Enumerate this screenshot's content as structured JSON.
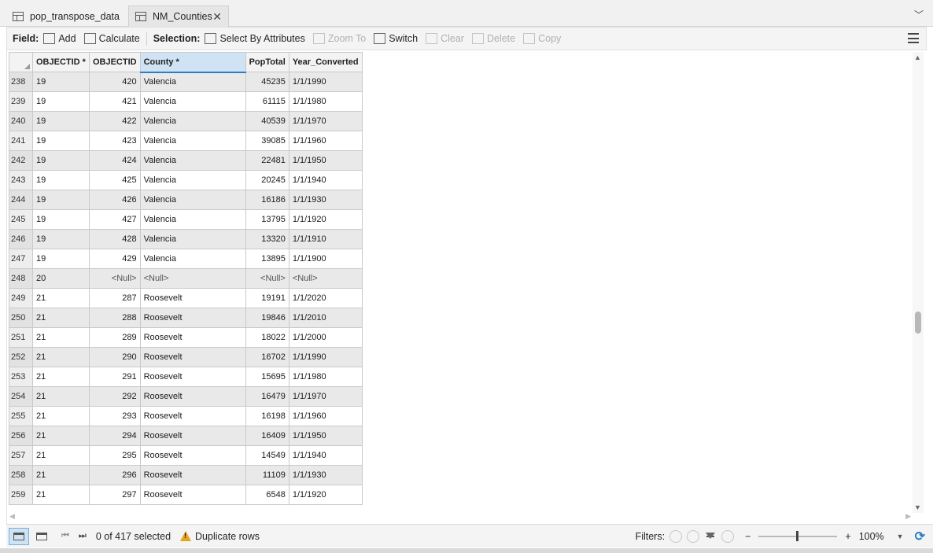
{
  "tabs": [
    {
      "label": "pop_transpose_data",
      "active": false
    },
    {
      "label": "NM_Counties",
      "active": true
    }
  ],
  "toolbar": {
    "field_label": "Field:",
    "add_label": "Add",
    "calculate_label": "Calculate",
    "selection_label": "Selection:",
    "select_by_attributes_label": "Select By Attributes",
    "zoom_to_label": "Zoom To",
    "switch_label": "Switch",
    "clear_label": "Clear",
    "delete_label": "Delete",
    "copy_label": "Copy"
  },
  "table": {
    "columns": [
      "OBJECTID *",
      "OBJECTID",
      "County *",
      "PopTotal",
      "Year_Converted"
    ],
    "rows": [
      [
        "238",
        "19",
        "420",
        "Valencia",
        "45235",
        "1/1/1990"
      ],
      [
        "239",
        "19",
        "421",
        "Valencia",
        "61115",
        "1/1/1980"
      ],
      [
        "240",
        "19",
        "422",
        "Valencia",
        "40539",
        "1/1/1970"
      ],
      [
        "241",
        "19",
        "423",
        "Valencia",
        "39085",
        "1/1/1960"
      ],
      [
        "242",
        "19",
        "424",
        "Valencia",
        "22481",
        "1/1/1950"
      ],
      [
        "243",
        "19",
        "425",
        "Valencia",
        "20245",
        "1/1/1940"
      ],
      [
        "244",
        "19",
        "426",
        "Valencia",
        "16186",
        "1/1/1930"
      ],
      [
        "245",
        "19",
        "427",
        "Valencia",
        "13795",
        "1/1/1920"
      ],
      [
        "246",
        "19",
        "428",
        "Valencia",
        "13320",
        "1/1/1910"
      ],
      [
        "247",
        "19",
        "429",
        "Valencia",
        "13895",
        "1/1/1900"
      ],
      [
        "248",
        "20",
        "<Null>",
        "<Null>",
        "<Null>",
        "<Null>"
      ],
      [
        "249",
        "21",
        "287",
        "Roosevelt",
        "19191",
        "1/1/2020"
      ],
      [
        "250",
        "21",
        "288",
        "Roosevelt",
        "19846",
        "1/1/2010"
      ],
      [
        "251",
        "21",
        "289",
        "Roosevelt",
        "18022",
        "1/1/2000"
      ],
      [
        "252",
        "21",
        "290",
        "Roosevelt",
        "16702",
        "1/1/1990"
      ],
      [
        "253",
        "21",
        "291",
        "Roosevelt",
        "15695",
        "1/1/1980"
      ],
      [
        "254",
        "21",
        "292",
        "Roosevelt",
        "16479",
        "1/1/1970"
      ],
      [
        "255",
        "21",
        "293",
        "Roosevelt",
        "16198",
        "1/1/1960"
      ],
      [
        "256",
        "21",
        "294",
        "Roosevelt",
        "16409",
        "1/1/1950"
      ],
      [
        "257",
        "21",
        "295",
        "Roosevelt",
        "14549",
        "1/1/1940"
      ],
      [
        "258",
        "21",
        "296",
        "Roosevelt",
        "11109",
        "1/1/1930"
      ],
      [
        "259",
        "21",
        "297",
        "Roosevelt",
        "6548",
        "1/1/1920"
      ]
    ]
  },
  "status": {
    "selected_text": "0 of 417 selected",
    "duplicate_rows_label": "Duplicate rows",
    "filters_label": "Filters:",
    "zoom_minus": "−",
    "zoom_plus": "+",
    "zoom_value": "100%"
  },
  "icons": {
    "table": "table-icon",
    "close": "close-icon",
    "warning": "warning-icon",
    "refresh": "refresh-icon"
  },
  "colors": {
    "selected_column_header": "#cfe3f4",
    "selected_column_underline": "#2d7ec4",
    "warning": "#e7a520"
  }
}
